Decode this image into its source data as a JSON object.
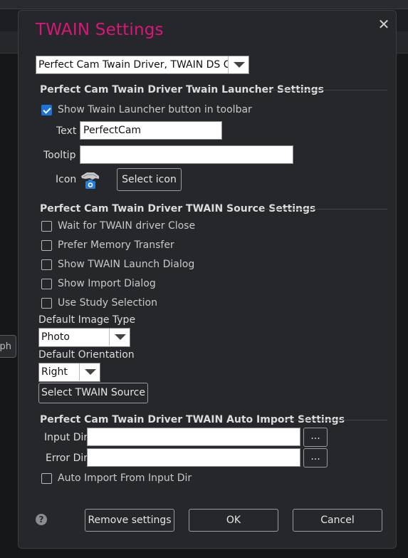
{
  "background": {
    "side_button_label": "ph"
  },
  "dialog": {
    "title": "TWAIN Settings",
    "close_symbol": "✕",
    "driver_select_value": "Perfect Cam Twain Driver, TWAIN DS Clas...",
    "launcher": {
      "section_title": "Perfect Cam Twain Driver Twain Launcher Settings",
      "show_button_label": "Show Twain Launcher button in toolbar",
      "show_button_checked": true,
      "text_label": "Text",
      "text_value": "PerfectCam",
      "tooltip_label": "Tooltip",
      "tooltip_value": "",
      "icon_label": "Icon",
      "icon_name": "camera-hand-icon",
      "select_icon_label": "Select icon"
    },
    "source": {
      "section_title": "Perfect Cam Twain Driver TWAIN Source Settings",
      "options": [
        {
          "label": "Wait for TWAIN driver Close",
          "checked": false
        },
        {
          "label": "Prefer Memory Transfer",
          "checked": false
        },
        {
          "label": "Show TWAIN Launch Dialog",
          "checked": false
        },
        {
          "label": "Show Import Dialog",
          "checked": false
        },
        {
          "label": "Use Study Selection",
          "checked": false
        }
      ],
      "image_type_label": "Default Image Type",
      "image_type_value": "Photo",
      "orientation_label": "Default Orientation",
      "orientation_value": "Right",
      "select_source_label": "Select TWAIN Source"
    },
    "auto_import": {
      "section_title": "Perfect Cam Twain Driver TWAIN Auto Import Settings",
      "input_dir_label": "Input Dir",
      "input_dir_value": "",
      "error_dir_label": "Error Dir",
      "error_dir_value": "",
      "browse_label": "...",
      "auto_import_label": "Auto Import From Input Dir",
      "auto_import_checked": false
    },
    "footer": {
      "help_symbol": "?",
      "remove_label": "Remove settings",
      "ok_label": "OK",
      "cancel_label": "Cancel"
    }
  },
  "colors": {
    "title": "#d9167a",
    "accent": "#1d74d6",
    "camera_blue": "#2a7fd4"
  }
}
